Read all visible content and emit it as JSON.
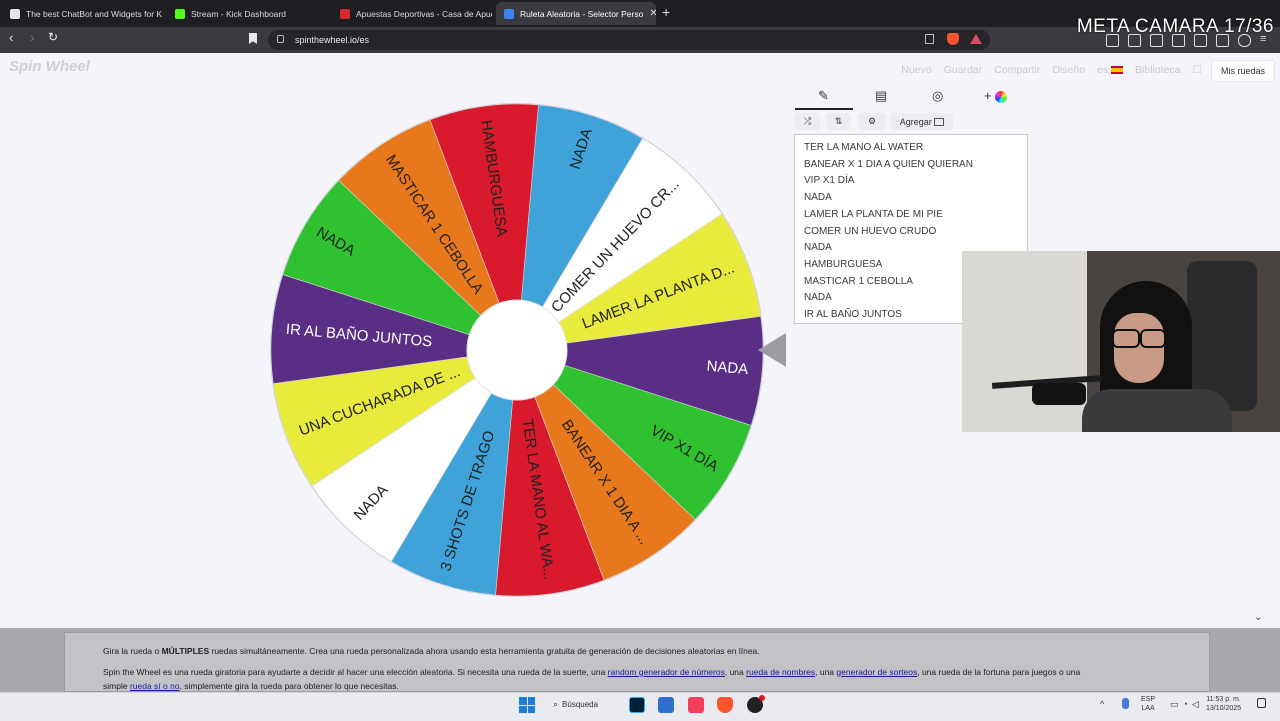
{
  "browser": {
    "tabs": [
      {
        "title": "The best ChatBot and Widgets for Ki",
        "color": "#e6e6e6"
      },
      {
        "title": "Stream - Kick Dashboard",
        "color": "#53fc18"
      },
      {
        "title": "Apuestas Deportivas - Casa de Apue",
        "color": "#d12d2d"
      },
      {
        "title": "Ruleta Aleatoria - Selector Perso",
        "color": "#3b82f6",
        "close": "✕"
      }
    ],
    "new_tab": "+",
    "url": "spinthewheel.io/es"
  },
  "overlay_text": "META CAMARA 17/36",
  "site": {
    "logo": "Spin Wheel",
    "nav": [
      "Nuevo",
      "Guardar",
      "Compartir",
      "Diseño",
      "es",
      "Biblioteca"
    ],
    "mis_ruedas": "Mis ruedas"
  },
  "wheel": {
    "segments": [
      {
        "label": "NADA",
        "color": "#3fa2d9"
      },
      {
        "label": "COMER UN HUEVO CR...",
        "color": "#ffffff"
      },
      {
        "label": "LAMER LA PLANTA D...",
        "color": "#e8ea3c"
      },
      {
        "label": "NADA",
        "color": "#5b2e86"
      },
      {
        "label": "VIP X1 DÍA",
        "color": "#2fc12f"
      },
      {
        "label": "BANEAR X 1 DIA A ...",
        "color": "#e8781c"
      },
      {
        "label": "TER LA MANO AL WA...",
        "color": "#d81a2c"
      },
      {
        "label": "3 SHOTS DE TRAGO",
        "color": "#3fa2d9"
      },
      {
        "label": "NADA",
        "color": "#ffffff"
      },
      {
        "label": "UNA CUCHARADA DE ...",
        "color": "#e8ea3c"
      },
      {
        "label": "IR AL BAÑO JUNTOS",
        "color": "#5b2e86"
      },
      {
        "label": "NADA",
        "color": "#2fc12f"
      },
      {
        "label": "MASTICAR 1 CEBOLLA",
        "color": "#e8781c"
      },
      {
        "label": "HAMBURGUESA",
        "color": "#d81a2c"
      }
    ]
  },
  "panel": {
    "tab_icons": [
      "pencil-icon",
      "clipboard-icon",
      "eye-off-icon",
      "plus-color-icon"
    ],
    "shuffle_icon": "⤮",
    "sort_icon": "⇅",
    "settings_icon": "⚙",
    "add_button": "Agregar",
    "entries": [
      "TER LA MANO AL WATER",
      "BANEAR X 1 DIA A QUIEN QUIERAN",
      "VIP X1 DÍA",
      "NADA",
      "LAMER LA PLANTA DE MI PIE",
      "COMER UN HUEVO CRUDO",
      "NADA",
      "HAMBURGUESA",
      "MASTICAR 1 CEBOLLA",
      "NADA",
      "IR AL BAÑO JUNTOS"
    ]
  },
  "info": {
    "line1_a": "Gira la rueda o ",
    "line1_bold": "MÚLTIPLES",
    "line1_b": " ruedas simultáneamente. Crea una rueda personalizada ahora usando esta herramienta gratuita de generación de decisiones aleatorias en línea.",
    "line2_a": "Spin the Wheel es una rueda giratoria para ayudarte a decidir al hacer una elección aleatoria. Si necesita una rueda de la suerte, una ",
    "link1": "random generador de números",
    "line2_b": ", una ",
    "link2": "rueda de nombres",
    "line2_c": ", una ",
    "link3": "generador de sorteos",
    "line2_d": ", una rueda de la fortuna para juegos o una",
    "line3_a": "simple ",
    "link4": "rueda sí o no",
    "line3_b": ", simplemente gira la rueda para obtener lo que necesitas."
  },
  "taskbar": {
    "search": "Búsqueda",
    "lang_top": "ESP",
    "lang_bottom": "LAA",
    "time": "11:53 p. m.",
    "date": "13/10/2025"
  }
}
